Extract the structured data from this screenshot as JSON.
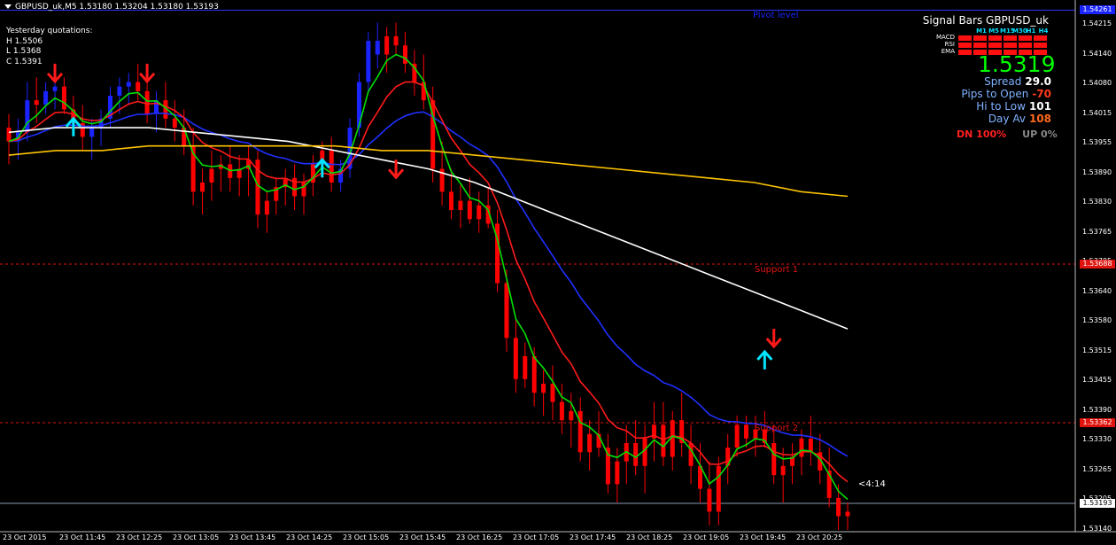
{
  "header": {
    "symbol_line": "GBPUSD_uk,M5  1.53180 1.53204 1.53180 1.53193"
  },
  "yesterday": {
    "title": "Yesterday quotations:",
    "high": "H 1.5506",
    "low": "L 1.5368",
    "close": "C 1.5391"
  },
  "panel": {
    "title": "Signal Bars GBPUSD_uk",
    "timeframes": [
      "M1",
      "M5",
      "M15",
      "M30",
      "H1",
      "H4"
    ],
    "indicators": [
      "MACD",
      "RSI",
      "EMA"
    ],
    "price": "1.5319",
    "spread_label": "Spread",
    "spread_value": "29.0",
    "pips_label": "Pips to Open",
    "pips_value": "-70",
    "hilo_label": "Hi to Low",
    "hilo_value": "101",
    "dayav_label": "Day Av",
    "dayav_value": "108",
    "dn": "DN 100%",
    "up": "UP 0%"
  },
  "levels": {
    "pivot_label": "Pivot level",
    "support1_label": "Support 1",
    "support2_label": "Support 2",
    "pivot_price": "1.54261",
    "support1_price": "1.53688",
    "support2_price": "1.53362",
    "current_price": "1.53193"
  },
  "timer": "<4:14",
  "yaxis": [
    "1.54215",
    "1.54140",
    "1.54080",
    "1.54015",
    "1.53955",
    "1.53890",
    "1.53830",
    "1.53765",
    "1.53705",
    "1.53640",
    "1.53580",
    "1.53515",
    "1.53455",
    "1.53390",
    "1.53330",
    "1.53265",
    "1.53205",
    "1.53140"
  ],
  "xaxis": [
    "23 Oct 2015",
    "23 Oct 11:45",
    "23 Oct 12:25",
    "23 Oct 13:05",
    "23 Oct 13:45",
    "23 Oct 14:25",
    "23 Oct 15:05",
    "23 Oct 15:45",
    "23 Oct 16:25",
    "23 Oct 17:05",
    "23 Oct 17:45",
    "23 Oct 18:25",
    "23 Oct 19:05",
    "23 Oct 19:45",
    "23 Oct 20:25"
  ],
  "colors": {
    "bull": "#1a24ff",
    "bear": "#ff0000",
    "ema_fast": "#00e000",
    "ema_mid": "#ff1a1a",
    "ema_slow": "#2030ff",
    "ema_white": "#ffffff",
    "ema_gold": "#ffc400",
    "arrow_up": "#00e5ff",
    "arrow_down": "#ff1a1a"
  },
  "chart_data": {
    "type": "candlestick",
    "symbol": "GBPUSD_uk",
    "timeframe": "M5",
    "ylim": [
      1.5312,
      1.5426
    ],
    "candles": [
      [
        1.54,
        1.5403,
        1.5392,
        1.5397
      ],
      [
        1.5397,
        1.5402,
        1.5393,
        1.5399
      ],
      [
        1.5399,
        1.541,
        1.5397,
        1.5406
      ],
      [
        1.5406,
        1.5411,
        1.5401,
        1.5405
      ],
      [
        1.5405,
        1.541,
        1.5403,
        1.5408
      ],
      [
        1.5408,
        1.5412,
        1.5404,
        1.5409
      ],
      [
        1.5409,
        1.5411,
        1.5403,
        1.5404
      ],
      [
        1.5404,
        1.5407,
        1.5399,
        1.5401
      ],
      [
        1.5401,
        1.5405,
        1.5395,
        1.5398
      ],
      [
        1.5398,
        1.5402,
        1.5393,
        1.54
      ],
      [
        1.54,
        1.5404,
        1.5396,
        1.5402
      ],
      [
        1.5402,
        1.5409,
        1.54,
        1.5407
      ],
      [
        1.5407,
        1.5411,
        1.5403,
        1.5409
      ],
      [
        1.5409,
        1.5412,
        1.5405,
        1.541
      ],
      [
        1.541,
        1.5414,
        1.5406,
        1.5408
      ],
      [
        1.5408,
        1.541,
        1.5401,
        1.5403
      ],
      [
        1.5403,
        1.5408,
        1.5399,
        1.5406
      ],
      [
        1.5406,
        1.541,
        1.54,
        1.5402
      ],
      [
        1.5402,
        1.5406,
        1.5397,
        1.54
      ],
      [
        1.54,
        1.5404,
        1.5394,
        1.5396
      ],
      [
        1.5396,
        1.54,
        1.5383,
        1.5386
      ],
      [
        1.5386,
        1.5391,
        1.5381,
        1.5388
      ],
      [
        1.5388,
        1.5395,
        1.5384,
        1.5391
      ],
      [
        1.5391,
        1.5394,
        1.5386,
        1.5392
      ],
      [
        1.5392,
        1.5396,
        1.5386,
        1.5389
      ],
      [
        1.5389,
        1.5394,
        1.5385,
        1.5391
      ],
      [
        1.5391,
        1.5396,
        1.5385,
        1.5393
      ],
      [
        1.5393,
        1.5395,
        1.5378,
        1.5381
      ],
      [
        1.5381,
        1.5386,
        1.5377,
        1.5384
      ],
      [
        1.5384,
        1.5389,
        1.5381,
        1.5387
      ],
      [
        1.5387,
        1.5391,
        1.5383,
        1.5389
      ],
      [
        1.5389,
        1.5392,
        1.5382,
        1.5385
      ],
      [
        1.5385,
        1.539,
        1.5381,
        1.5388
      ],
      [
        1.5388,
        1.5394,
        1.5385,
        1.5392
      ],
      [
        1.5392,
        1.5397,
        1.5389,
        1.5395
      ],
      [
        1.5395,
        1.5398,
        1.5386,
        1.5388
      ],
      [
        1.5388,
        1.5393,
        1.5386,
        1.5391
      ],
      [
        1.5391,
        1.5402,
        1.5389,
        1.54
      ],
      [
        1.54,
        1.5412,
        1.5398,
        1.541
      ],
      [
        1.541,
        1.5421,
        1.5408,
        1.5419
      ],
      [
        1.5419,
        1.5423,
        1.5413,
        1.5416
      ],
      [
        1.5416,
        1.5422,
        1.5412,
        1.542
      ],
      [
        1.542,
        1.5423,
        1.5416,
        1.5418
      ],
      [
        1.5418,
        1.5421,
        1.5412,
        1.5414
      ],
      [
        1.5414,
        1.5417,
        1.5407,
        1.541
      ],
      [
        1.541,
        1.5416,
        1.5404,
        1.5406
      ],
      [
        1.5406,
        1.5409,
        1.5388,
        1.5391
      ],
      [
        1.5391,
        1.5397,
        1.5383,
        1.5386
      ],
      [
        1.5386,
        1.5391,
        1.538,
        1.5382
      ],
      [
        1.5382,
        1.5388,
        1.5378,
        1.5384
      ],
      [
        1.5384,
        1.5389,
        1.5379,
        1.538
      ],
      [
        1.538,
        1.5386,
        1.5377,
        1.5383
      ],
      [
        1.5383,
        1.5387,
        1.5378,
        1.5379
      ],
      [
        1.5379,
        1.5382,
        1.5364,
        1.5366
      ],
      [
        1.5366,
        1.5369,
        1.5351,
        1.5354
      ],
      [
        1.5354,
        1.5358,
        1.5342,
        1.5345
      ],
      [
        1.5345,
        1.5353,
        1.5343,
        1.535
      ],
      [
        1.535,
        1.5352,
        1.5339,
        1.5342
      ],
      [
        1.5342,
        1.5347,
        1.5337,
        1.5344
      ],
      [
        1.5344,
        1.5348,
        1.5336,
        1.534
      ],
      [
        1.534,
        1.5344,
        1.5333,
        1.5336
      ],
      [
        1.5336,
        1.5342,
        1.533,
        1.5338
      ],
      [
        1.5338,
        1.5341,
        1.5327,
        1.5329
      ],
      [
        1.5329,
        1.5336,
        1.5325,
        1.5333
      ],
      [
        1.5333,
        1.5338,
        1.5328,
        1.533
      ],
      [
        1.533,
        1.5333,
        1.532,
        1.5322
      ],
      [
        1.5322,
        1.533,
        1.5318,
        1.5327
      ],
      [
        1.5327,
        1.5335,
        1.5322,
        1.5331
      ],
      [
        1.5331,
        1.5336,
        1.5324,
        1.5326
      ],
      [
        1.5326,
        1.5335,
        1.532,
        1.5332
      ],
      [
        1.5332,
        1.534,
        1.5327,
        1.5335
      ],
      [
        1.5335,
        1.534,
        1.5326,
        1.5328
      ],
      [
        1.5328,
        1.5338,
        1.5325,
        1.5336
      ],
      [
        1.5336,
        1.5342,
        1.5328,
        1.5331
      ],
      [
        1.5331,
        1.5335,
        1.5322,
        1.5326
      ],
      [
        1.5326,
        1.5331,
        1.5318,
        1.5321
      ],
      [
        1.5321,
        1.5327,
        1.5313,
        1.5316
      ],
      [
        1.5316,
        1.5328,
        1.5313,
        1.5326
      ],
      [
        1.5326,
        1.5333,
        1.5322,
        1.533
      ],
      [
        1.533,
        1.5337,
        1.5328,
        1.5335
      ],
      [
        1.5335,
        1.5337,
        1.533,
        1.5332
      ],
      [
        1.5332,
        1.5337,
        1.5328,
        1.5334
      ],
      [
        1.5334,
        1.5338,
        1.533,
        1.5331
      ],
      [
        1.5331,
        1.5335,
        1.5322,
        1.5324
      ],
      [
        1.5324,
        1.533,
        1.5318,
        1.5326
      ],
      [
        1.5326,
        1.5331,
        1.5322,
        1.5328
      ],
      [
        1.5328,
        1.5334,
        1.5324,
        1.5332
      ],
      [
        1.5332,
        1.5337,
        1.5326,
        1.5329
      ],
      [
        1.5329,
        1.5333,
        1.5322,
        1.5325
      ],
      [
        1.5325,
        1.533,
        1.5317,
        1.5319
      ],
      [
        1.5319,
        1.5322,
        1.5312,
        1.5315
      ],
      [
        1.5315,
        1.5318,
        1.5312,
        1.5316
      ]
    ],
    "ema_white": [
      1.5399,
      1.54,
      1.54,
      1.54,
      1.5399,
      1.5398,
      1.5397,
      1.5395,
      1.5393,
      1.5391,
      1.5388,
      1.5384,
      1.538,
      1.5376,
      1.5372,
      1.5368,
      1.5364,
      1.536,
      1.5356
    ],
    "ema_gold": [
      1.5394,
      1.5395,
      1.5395,
      1.5396,
      1.5396,
      1.5396,
      1.5396,
      1.5396,
      1.5395,
      1.5395,
      1.5394,
      1.5393,
      1.5392,
      1.5391,
      1.539,
      1.5389,
      1.5388,
      1.5386,
      1.5385
    ]
  }
}
